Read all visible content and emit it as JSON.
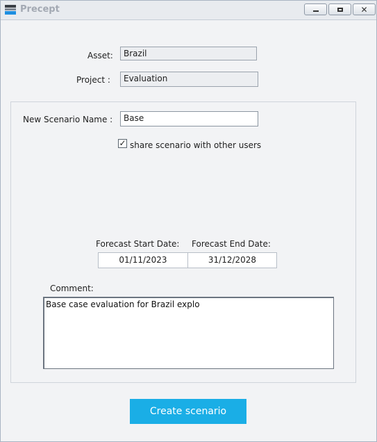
{
  "window": {
    "title": "Precept",
    "controls": {
      "minimize": "minimize-icon",
      "maximize": "maximize-icon",
      "close": "close-icon"
    }
  },
  "form": {
    "asset_label": "Asset:",
    "asset_value": "Brazil",
    "project_label": "Project :",
    "project_value": "Evaluation",
    "scenario_name_label": "New Scenario Name :",
    "scenario_name_value": "Base",
    "share_label": "share scenario with other users",
    "share_checked": true,
    "forecast_start_label": "Forecast Start Date:",
    "forecast_start_value": "01/11/2023",
    "forecast_end_label": "Forecast End Date:",
    "forecast_end_value": "31/12/2028",
    "comment_label": "Comment:",
    "comment_value": "Base case evaluation for Brazil explo",
    "create_button_label": "Create scenario"
  },
  "colors": {
    "accent": "#1aaee6",
    "window_bg": "#f2f3f5"
  }
}
